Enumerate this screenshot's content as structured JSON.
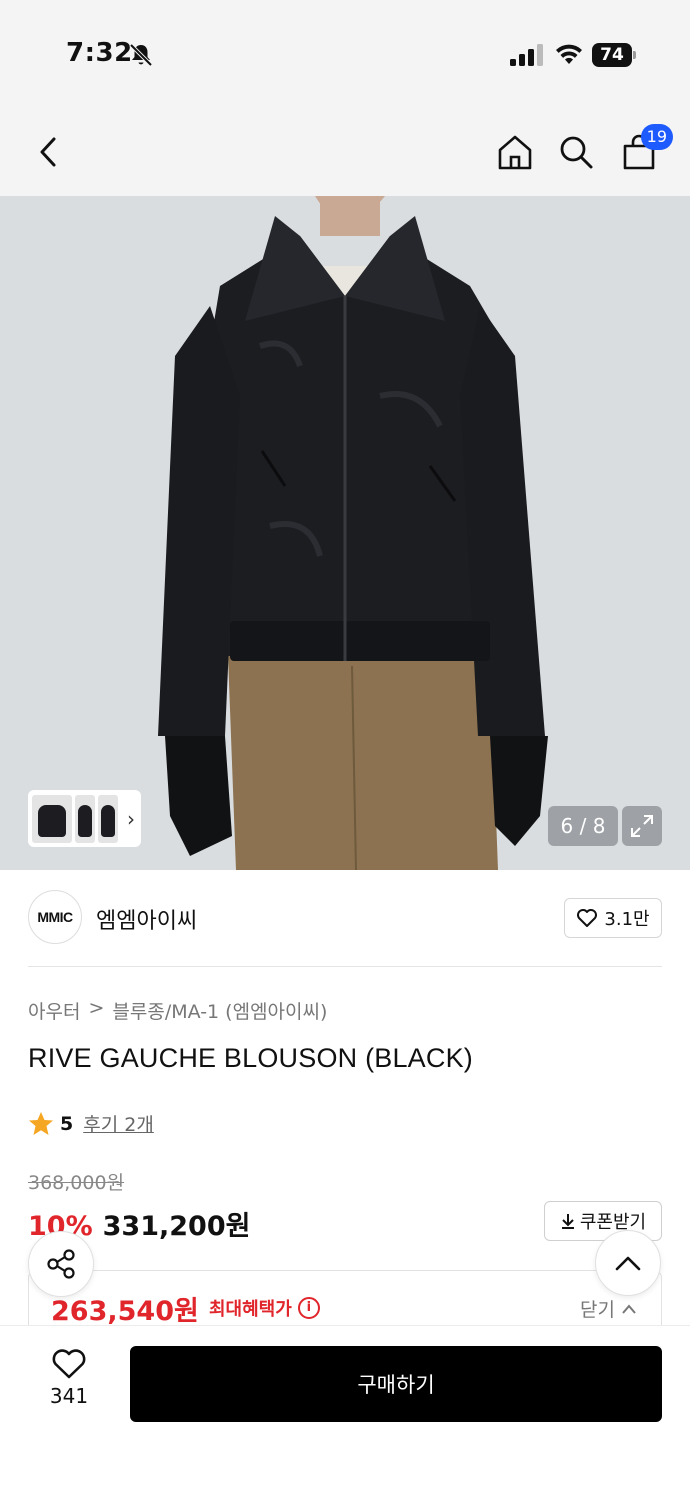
{
  "status_bar": {
    "time": "7:32",
    "battery": "74",
    "icons": [
      "bell-slash-icon",
      "signal-icon",
      "wifi-icon",
      "battery-icon"
    ]
  },
  "nav": {
    "icons": [
      "back-arrow-icon",
      "home-icon",
      "search-icon",
      "cart-icon"
    ],
    "cart_count": "19"
  },
  "gallery": {
    "counter": "6 / 8",
    "thumb_arrow": "›"
  },
  "brand": {
    "logo_text": "MMIC",
    "name": "엠엠아이씨",
    "likes": "3.1만"
  },
  "breadcrumb": {
    "category": "아우터",
    "separator": ">",
    "subcategory": "블루종/MA-1 (엠엠아이씨)"
  },
  "product": {
    "title": "RIVE GAUCHE BLOUSON (BLACK)",
    "rating": "5",
    "review_label": "후기 2개"
  },
  "price": {
    "original": "368,000원",
    "discount": "10%",
    "sale": "331,200원",
    "coupon_label": "쿠폰받기",
    "benefit_price": "263,540원",
    "benefit_label": "최대혜택가",
    "close_label": "닫기"
  },
  "bottom": {
    "wish_count": "341",
    "buy_label": "구매하기"
  },
  "colors": {
    "accent_red": "#e0252b",
    "badge_blue": "#1e5bff",
    "star": "#f5a623",
    "buy_button": "#000000"
  }
}
